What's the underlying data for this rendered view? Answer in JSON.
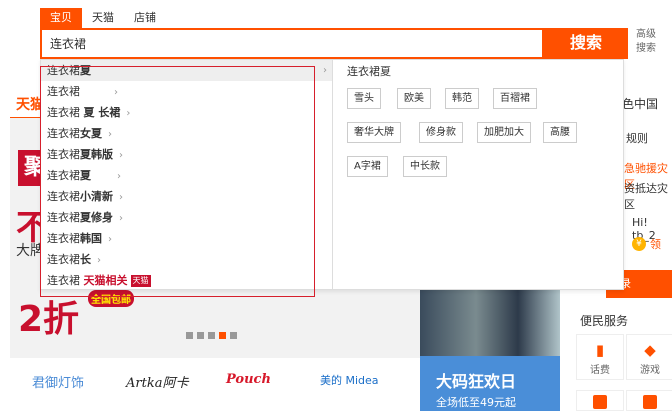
{
  "tabs": [
    {
      "label": "宝贝",
      "active": true
    },
    {
      "label": "天猫",
      "active": false
    },
    {
      "label": "店铺",
      "active": false
    }
  ],
  "search": {
    "value": "连衣裙",
    "button_label": "搜索"
  },
  "advanced": {
    "line1": "高级",
    "line2": "搜索"
  },
  "suggestions": [
    {
      "prefix": "连衣裙",
      "bold": "夏",
      "active": true
    },
    {
      "prefix": "连衣裙",
      "bold": ""
    },
    {
      "prefix": "连衣裙 ",
      "bold": "夏 长裙"
    },
    {
      "prefix": "连衣裙",
      "bold": "女夏"
    },
    {
      "prefix": "连衣裙",
      "bold": "夏韩版"
    },
    {
      "prefix": "连衣裙",
      "bold": "夏"
    },
    {
      "prefix": "连衣裙",
      "bold": "小清新"
    },
    {
      "prefix": "连衣裙",
      "bold": "夏修身"
    },
    {
      "prefix": "连衣裙",
      "bold": "韩国"
    },
    {
      "prefix": "连衣裙",
      "bold": "长"
    }
  ],
  "tmall_item": {
    "prefix": "连衣裙",
    "tm_text": "天猫相关",
    "badge": "天猫"
  },
  "related": {
    "title": "连衣裙夏",
    "tags": [
      "雪头",
      "欧美",
      "韩范",
      "百褶裙",
      "奢华大牌",
      "修身款",
      "加肥加大",
      "高腰",
      "A字裙",
      "中长款"
    ]
  },
  "background": {
    "tianmao": "天猫",
    "ju": "聚",
    "bu": "不",
    "dapai": "大牌",
    "erzhe": "2折",
    "baoyou": "全国包邮",
    "brands": [
      "君御灯饰",
      "Artka阿卡",
      "Pouch",
      "美的 Midea"
    ],
    "promo_title": "大码狂欢日",
    "promo_sub": "全场低至49元起",
    "carousel": {
      "count": 5,
      "active_index": 3
    }
  },
  "right": {
    "tese": "色中国",
    "guize": "规则",
    "line1": "急驰援灾区",
    "line2": "资抵达灾区",
    "hi": "Hi! tb_2",
    "coin": "领",
    "login": "录",
    "bianmin": "便民服务",
    "services": [
      "话费",
      "游戏"
    ]
  }
}
